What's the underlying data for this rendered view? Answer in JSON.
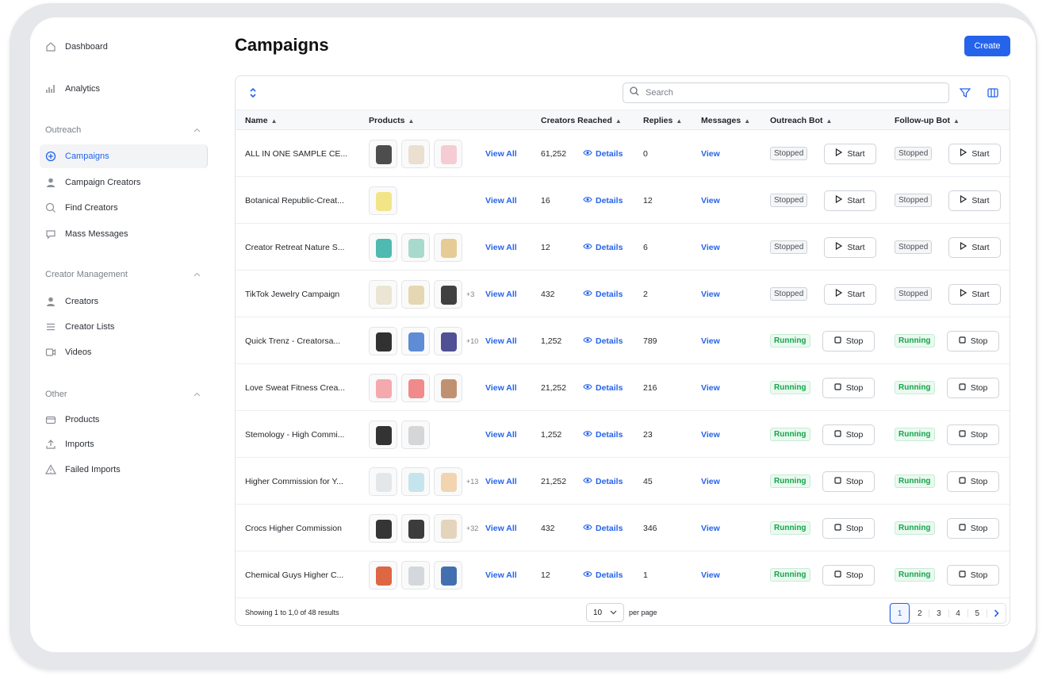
{
  "sidebar": {
    "top_items": [
      {
        "label": "Dashboard",
        "icon": "home-icon"
      },
      {
        "label": "Analytics",
        "icon": "bar-chart-icon"
      }
    ],
    "sections": [
      {
        "label": "Outreach",
        "items": [
          {
            "label": "Campaigns",
            "icon": "target-icon",
            "active": true
          },
          {
            "label": "Campaign Creators",
            "icon": "person-icon"
          },
          {
            "label": "Find Creators",
            "icon": "search-icon"
          },
          {
            "label": "Mass Messages",
            "icon": "chat-icon"
          }
        ]
      },
      {
        "label": "Creator Management",
        "items": [
          {
            "label": "Creators",
            "icon": "person-icon"
          },
          {
            "label": "Creator Lists",
            "icon": "list-icon"
          },
          {
            "label": "Videos",
            "icon": "video-icon"
          }
        ]
      },
      {
        "label": "Other",
        "items": [
          {
            "label": "Products",
            "icon": "box-icon"
          },
          {
            "label": "Imports",
            "icon": "upload-icon"
          },
          {
            "label": "Failed Imports",
            "icon": "warning-icon"
          }
        ]
      }
    ]
  },
  "page": {
    "title": "Campaigns",
    "create_label": "Create"
  },
  "search": {
    "placeholder": "Search"
  },
  "columns": {
    "name": "Name",
    "products": "Products",
    "creators_reached": "Creators Reached",
    "replies": "Replies",
    "messages": "Messages",
    "outreach_bot": "Outreach Bot",
    "followup_bot": "Follow-up Bot"
  },
  "labels": {
    "view_all": "View All",
    "details": "Details",
    "view": "View",
    "start": "Start",
    "stop": "Stop",
    "stopped": "Stopped",
    "running": "Running"
  },
  "rows": [
    {
      "name": "ALL IN ONE SAMPLE CE...",
      "thumbs": [
        "#3a3a3a",
        "#e8dccb",
        "#f4c7cf"
      ],
      "more": "",
      "reached": "61,252",
      "replies": "0",
      "running": false
    },
    {
      "name": "Botanical Republic-Creat...",
      "thumbs": [
        "#f1e27a"
      ],
      "more": "",
      "reached": "16",
      "replies": "12",
      "running": false
    },
    {
      "name": "Creator Retreat Nature S...",
      "thumbs": [
        "#3bb3a8",
        "#9fd6c5",
        "#e4c58a"
      ],
      "more": "",
      "reached": "12",
      "replies": "6",
      "running": false
    },
    {
      "name": "TikTok Jewelry Campaign",
      "thumbs": [
        "#e9e2cf",
        "#e2d3a8",
        "#2b2b2b"
      ],
      "more": "+3",
      "reached": "432",
      "replies": "2",
      "running": false
    },
    {
      "name": "Quick Trenz - Creatorsa...",
      "thumbs": [
        "#1b1b1b",
        "#4c7fd0",
        "#3d3d8a"
      ],
      "more": "+10",
      "reached": "1,252",
      "replies": "789",
      "running": true
    },
    {
      "name": "Love Sweat Fitness Crea...",
      "thumbs": [
        "#f3a0a6",
        "#ef7d7d",
        "#b98562"
      ],
      "more": "",
      "reached": "21,252",
      "replies": "216",
      "running": true
    },
    {
      "name": "Stemology - High Commi...",
      "thumbs": [
        "#1d1d1d",
        "#cfd1d4"
      ],
      "more": "",
      "reached": "1,252",
      "replies": "23",
      "running": true
    },
    {
      "name": "Higher Commission for Y...",
      "thumbs": [
        "#e1e4e8",
        "#bfe1ec",
        "#f0d0a8"
      ],
      "more": "+13",
      "reached": "21,252",
      "replies": "45",
      "running": true
    },
    {
      "name": "Crocs Higher Commission",
      "thumbs": [
        "#1f1f1f",
        "#272727",
        "#e0cfb4"
      ],
      "more": "+32",
      "reached": "432",
      "replies": "346",
      "running": true
    },
    {
      "name": "Chemical Guys Higher C...",
      "thumbs": [
        "#d9552f",
        "#cfd3d8",
        "#2f5fa8"
      ],
      "more": "",
      "reached": "12",
      "replies": "1",
      "running": true
    }
  ],
  "footer": {
    "showing": "Showing 1 to 1,0 of 48 results",
    "per_page_value": "10",
    "per_page_label": "per page",
    "pages": [
      "1",
      "2",
      "3",
      "4",
      "5"
    ],
    "active_page": "1"
  },
  "colors": {
    "accent": "#2563eb",
    "running": "#16a34a"
  }
}
